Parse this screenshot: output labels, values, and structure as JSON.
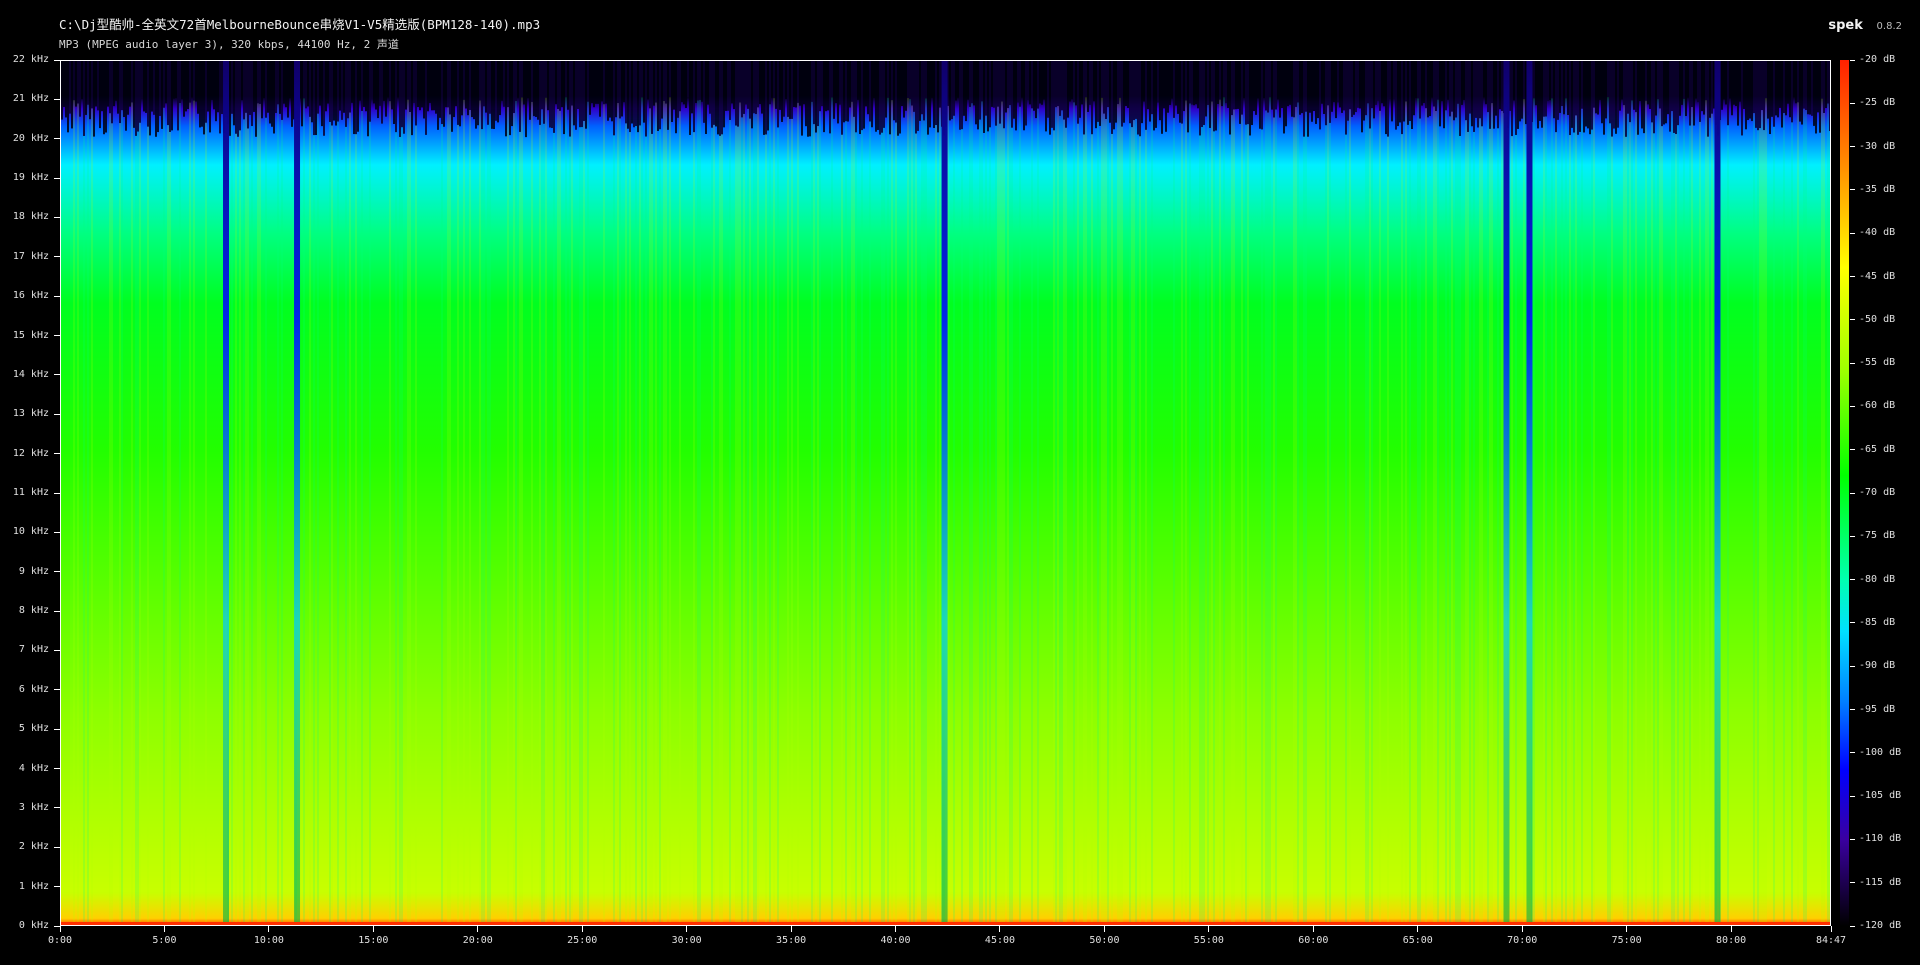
{
  "file": {
    "title": "C:\\Dj型酷帅-全英文72首MelbourneBounce串烧V1-V5精选版(BPM128-140).mp3",
    "info": "MP3 (MPEG audio layer 3), 320 kbps, 44100 Hz, 2 声道"
  },
  "app": {
    "name": "spek",
    "version": "0.8.2"
  },
  "chart_data": {
    "type": "heatmap",
    "title": "",
    "xlabel": "",
    "ylabel": "",
    "x_unit": "time (m:ss)",
    "y_unit": "kHz",
    "xlim": [
      "0:00",
      "84:47"
    ],
    "ylim": [
      0,
      22
    ],
    "y_ticks": [
      "0 kHz",
      "1 kHz",
      "2 kHz",
      "3 kHz",
      "4 kHz",
      "5 kHz",
      "6 kHz",
      "7 kHz",
      "8 kHz",
      "9 kHz",
      "10 kHz",
      "11 kHz",
      "12 kHz",
      "13 kHz",
      "14 kHz",
      "15 kHz",
      "16 kHz",
      "17 kHz",
      "18 kHz",
      "19 kHz",
      "20 kHz",
      "21 kHz",
      "22 kHz"
    ],
    "x_ticks": [
      "0:00",
      "5:00",
      "10:00",
      "15:00",
      "20:00",
      "25:00",
      "30:00",
      "35:00",
      "40:00",
      "45:00",
      "50:00",
      "55:00",
      "60:00",
      "65:00",
      "70:00",
      "75:00",
      "80:00",
      "84:47"
    ],
    "x_tick_minutes": [
      0,
      5,
      10,
      15,
      20,
      25,
      30,
      35,
      40,
      45,
      50,
      55,
      60,
      65,
      70,
      75,
      80,
      84.783
    ],
    "duration_minutes": 84.783,
    "colorbar": {
      "unit": "dB",
      "range": [
        -120,
        -20
      ],
      "ticks": [
        "-20 dB",
        "-25 dB",
        "-30 dB",
        "-35 dB",
        "-40 dB",
        "-45 dB",
        "-50 dB",
        "-55 dB",
        "-60 dB",
        "-65 dB",
        "-70 dB",
        "-75 dB",
        "-80 dB",
        "-85 dB",
        "-90 dB",
        "-95 dB",
        "-100 dB",
        "-105 dB",
        "-110 dB",
        "-115 dB",
        "-120 dB"
      ],
      "colors": [
        "#ff2400",
        "#ff9a00",
        "#ffff00",
        "#00ff00",
        "#00ffff",
        "#0000ff",
        "#24006e",
        "#000000"
      ]
    },
    "spectrum_cutoff_khz": 20.7,
    "dominant_level_db": -60,
    "low_energy_columns_minutes": [
      7.9,
      11.3,
      42.3,
      69.2,
      70.3,
      79.3
    ]
  }
}
